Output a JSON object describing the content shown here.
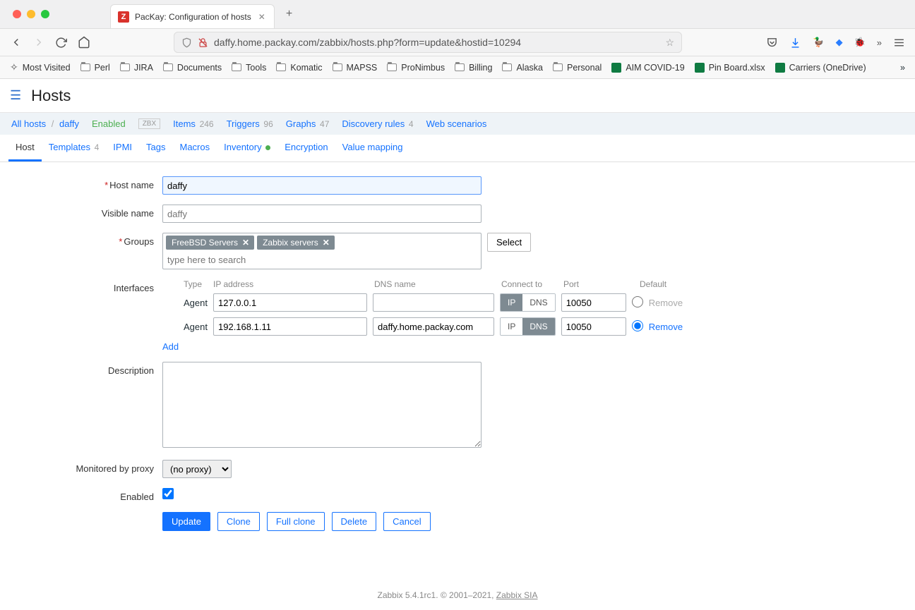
{
  "browser": {
    "tab_title": "PacKay: Configuration of hosts",
    "url": "daffy.home.packay.com/zabbix/hosts.php?form=update&hostid=10294",
    "bookmarks": [
      "Most Visited",
      "Perl",
      "JIRA",
      "Documents",
      "Tools",
      "Komatic",
      "MAPSS",
      "ProNimbus",
      "Billing",
      "Alaska",
      "Personal",
      "AIM COVID-19",
      "Pin Board.xlsx",
      "Carriers (OneDrive)"
    ]
  },
  "header": {
    "title": "Hosts"
  },
  "breadcrumb": {
    "all_hosts": "All hosts",
    "host": "daffy",
    "status": "Enabled",
    "zbx": "ZBX",
    "links": [
      {
        "label": "Items",
        "count": "246"
      },
      {
        "label": "Triggers",
        "count": "96"
      },
      {
        "label": "Graphs",
        "count": "47"
      },
      {
        "label": "Discovery rules",
        "count": "4"
      },
      {
        "label": "Web scenarios",
        "count": ""
      }
    ]
  },
  "tabs": [
    {
      "label": "Host",
      "active": true
    },
    {
      "label": "Templates",
      "count": "4"
    },
    {
      "label": "IPMI"
    },
    {
      "label": "Tags"
    },
    {
      "label": "Macros"
    },
    {
      "label": "Inventory",
      "dot": true
    },
    {
      "label": "Encryption"
    },
    {
      "label": "Value mapping"
    }
  ],
  "form": {
    "labels": {
      "hostname": "Host name",
      "visiblename": "Visible name",
      "groups": "Groups",
      "interfaces": "Interfaces",
      "description": "Description",
      "proxy": "Monitored by proxy",
      "enabled": "Enabled"
    },
    "hostname": "daffy",
    "visiblename_ph": "daffy",
    "groups": [
      "FreeBSD Servers",
      "Zabbix servers"
    ],
    "groups_ph": "type here to search",
    "select_btn": "Select",
    "iface_headers": {
      "type": "Type",
      "ip": "IP address",
      "dns": "DNS name",
      "connect": "Connect to",
      "port": "Port",
      "default": "Default"
    },
    "interfaces": [
      {
        "type": "Agent",
        "ip": "127.0.0.1",
        "dns": "",
        "connect": "IP",
        "port": "10050",
        "default": false,
        "remove": "Remove",
        "remove_enabled": false
      },
      {
        "type": "Agent",
        "ip": "192.168.1.11",
        "dns": "daffy.home.packay.com",
        "connect": "DNS",
        "port": "10050",
        "default": true,
        "remove": "Remove",
        "remove_enabled": true
      }
    ],
    "add_link": "Add",
    "proxy_value": "(no proxy)",
    "buttons": {
      "update": "Update",
      "clone": "Clone",
      "fullclone": "Full clone",
      "delete": "Delete",
      "cancel": "Cancel"
    }
  },
  "conn_opts": {
    "ip": "IP",
    "dns": "DNS"
  },
  "footer": {
    "text": "Zabbix 5.4.1rc1. © 2001–2021, ",
    "link": "Zabbix SIA"
  }
}
